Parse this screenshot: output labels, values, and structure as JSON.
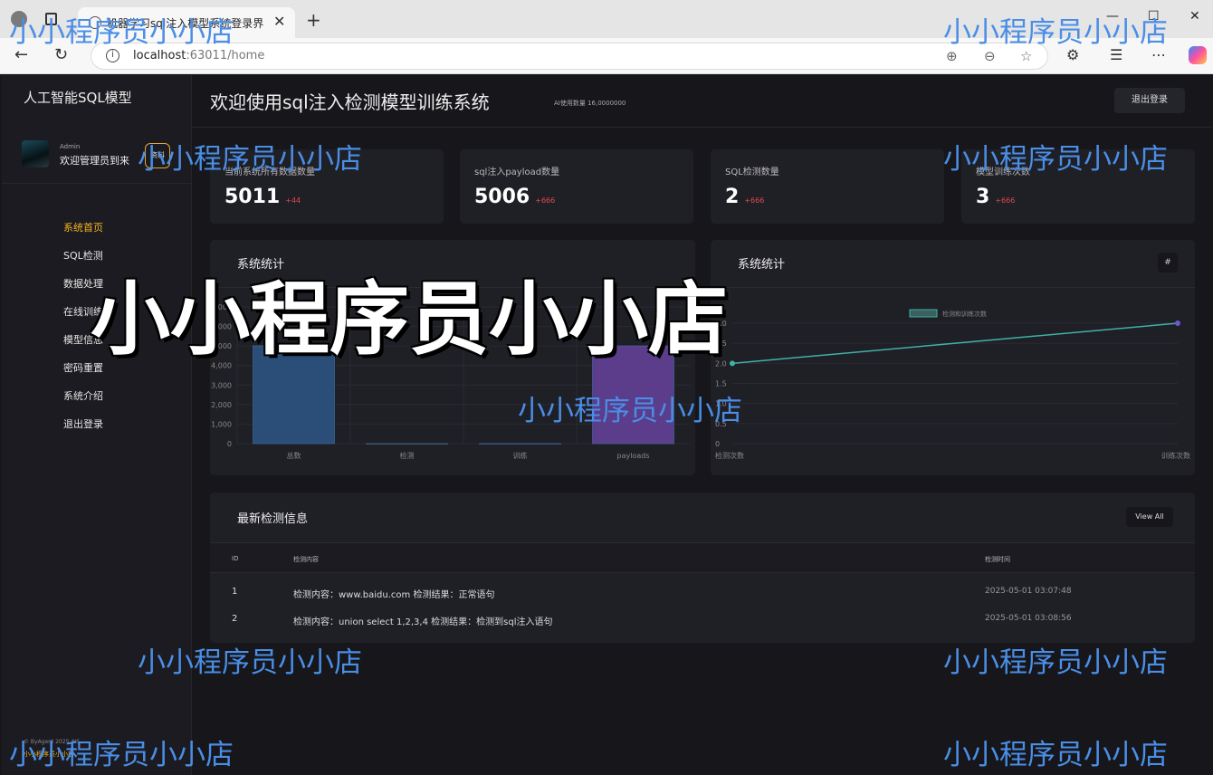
{
  "browser": {
    "tab_title": "机器学习sql注入模型系统登录界",
    "url_host": "localhost",
    "url_port_path": ":63011/home"
  },
  "sidebar": {
    "brand": "人工智能SQL模型",
    "user_role": "Admin",
    "user_welcome": "欢迎管理员到来",
    "user_button": "资料",
    "menu": [
      {
        "label": "系统首页",
        "active": true
      },
      {
        "label": "SQL检测",
        "active": false
      },
      {
        "label": "数据处理",
        "active": false
      },
      {
        "label": "在线训练",
        "active": false
      },
      {
        "label": "模型信息",
        "active": false
      },
      {
        "label": "密码重置",
        "active": false
      },
      {
        "label": "系统介绍",
        "active": false
      },
      {
        "label": "退出登录",
        "active": false
      }
    ],
    "footer_text": "© ByAgent 2025 AIS",
    "footer_brand": "小小程序员小小店"
  },
  "header": {
    "title": "欢迎使用sql注入检测模型训练系统",
    "subtitle": "AI使用数量 16,0000000",
    "logout": "退出登录"
  },
  "stats": [
    {
      "label": "当前系统所有数据数量",
      "value": "5011",
      "delta": "+44"
    },
    {
      "label": "sql注入payload数量",
      "value": "5006",
      "delta": "+666"
    },
    {
      "label": "SQL检测数量",
      "value": "2",
      "delta": "+666"
    },
    {
      "label": "模型训练次数",
      "value": "3",
      "delta": "+666"
    }
  ],
  "panels": {
    "left_title": "系统统计",
    "right_title": "系统统计",
    "right_button": "#"
  },
  "chart_data": [
    {
      "type": "bar",
      "categories": [
        "总数",
        "检测",
        "训练",
        "payloads"
      ],
      "values": [
        5011,
        2,
        3,
        5006
      ],
      "ylim": [
        0,
        7000
      ],
      "yticks": [
        "0",
        "1,000",
        "2,000",
        "3,000",
        "4,000",
        "5,000",
        "6,000",
        "7,000"
      ],
      "colors": [
        "#2b4e78",
        "#5a6a3a",
        "#3a5a5a",
        "#5b3d8c"
      ]
    },
    {
      "type": "line",
      "categories": [
        "检测次数",
        "训练次数"
      ],
      "series": [
        {
          "name": "检测和训练次数",
          "values": [
            2,
            3
          ]
        }
      ],
      "ylim": [
        0,
        3.0
      ],
      "yticks": [
        "0",
        "0.5",
        "1.0",
        "1.5",
        "2.0",
        "2.5",
        "3.0"
      ],
      "color": "#3fb1a6"
    }
  ],
  "table": {
    "title": "最新检测信息",
    "view_all": "View All",
    "headers": {
      "id": "ID",
      "content": "检测内容",
      "time": "检测时间"
    },
    "rows": [
      {
        "id": "1",
        "content": "检测内容：www.baidu.com 检测结果：正常语句",
        "time": "2025-05-01 03:07:48"
      },
      {
        "id": "2",
        "content": "检测内容：union select 1,2,3,4 检测结果：检测到sql注入语句",
        "time": "2025-05-01 03:08:56"
      }
    ]
  },
  "watermark": {
    "small": "小小程序员小小店",
    "big": "小小程序员小小店"
  },
  "colors": {
    "accent": "#f5b323",
    "delta": "#e04b4b",
    "bg": "#16161b",
    "card": "#1f1f26"
  }
}
